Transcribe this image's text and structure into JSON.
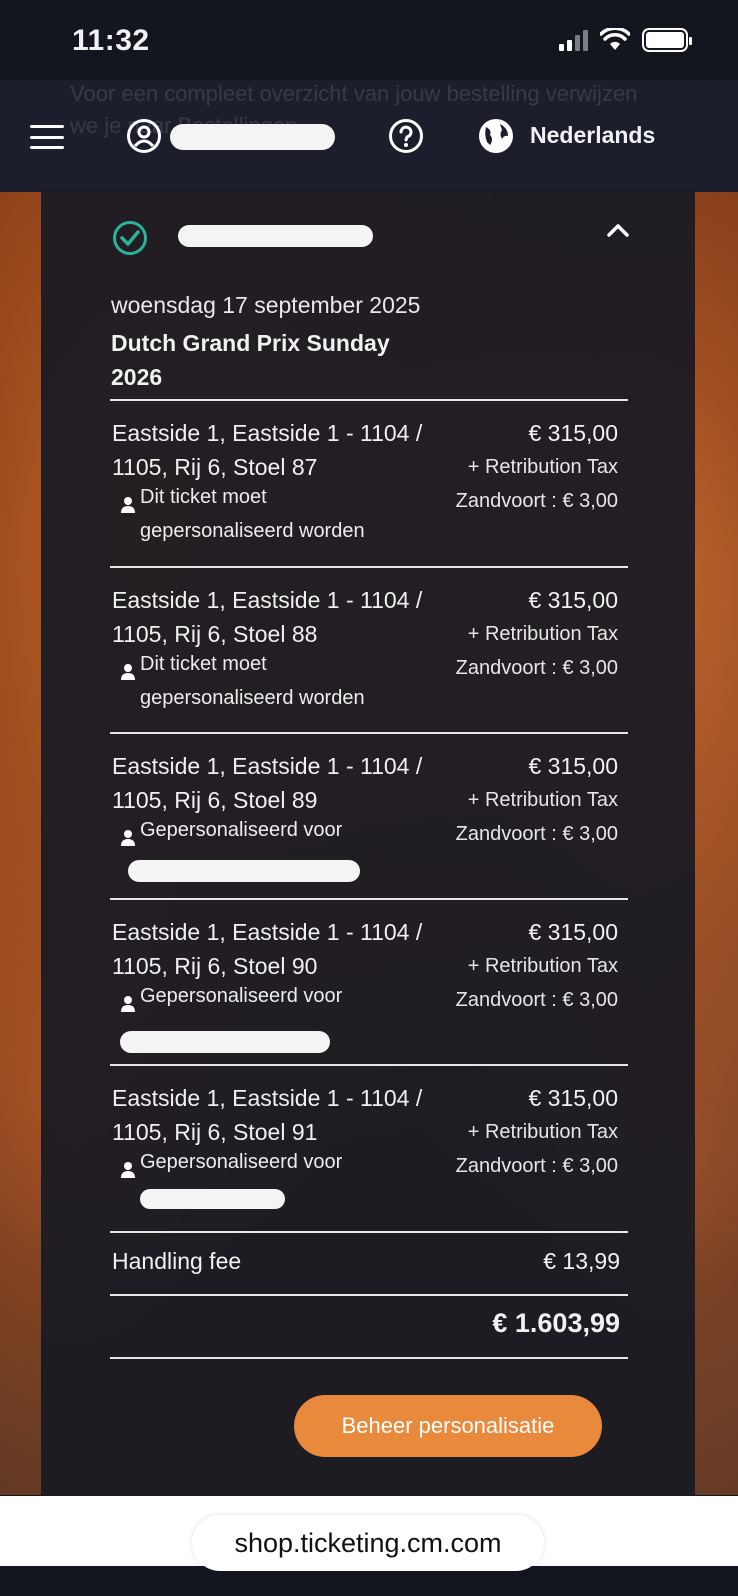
{
  "status_bar": {
    "time": "11:32"
  },
  "header": {
    "ghost_text": "Voor een compleet overzicht van jouw bestelling verwijzen we je naar Bestellingen",
    "language": "Nederlands"
  },
  "order": {
    "date": "woensdag 17 september 2025",
    "event": "Dutch Grand Prix Sunday 2026",
    "tickets": [
      {
        "name": "Eastside 1, Eastside 1 - 1104 / 1105, Rij 6, Stoel 87",
        "price": "€ 315,00",
        "tax_line1": "+ Retribution Tax",
        "tax_line2": "Zandvoort : € 3,00",
        "personalization": "Dit ticket moet gepersonaliseerd worden"
      },
      {
        "name": "Eastside 1, Eastside 1 - 1104 / 1105, Rij 6, Stoel 88",
        "price": "€ 315,00",
        "tax_line1": "+ Retribution Tax",
        "tax_line2": "Zandvoort : € 3,00",
        "personalization": "Dit ticket moet gepersonaliseerd worden"
      },
      {
        "name": "Eastside 1, Eastside 1 - 1104 / 1105, Rij 6, Stoel 89",
        "price": "€ 315,00",
        "tax_line1": "+ Retribution Tax",
        "tax_line2": "Zandvoort : € 3,00",
        "personalization": "Gepersonaliseerd voor"
      },
      {
        "name": "Eastside 1, Eastside 1 - 1104 / 1105, Rij 6, Stoel 90",
        "price": "€ 315,00",
        "tax_line1": "+ Retribution Tax",
        "tax_line2": "Zandvoort : € 3,00",
        "personalization": "Gepersonaliseerd voor"
      },
      {
        "name": "Eastside 1, Eastside 1 - 1104 / 1105, Rij 6, Stoel 91",
        "price": "€ 315,00",
        "tax_line1": "+ Retribution Tax",
        "tax_line2": "Zandvoort : € 3,00",
        "personalization": "Gepersonaliseerd voor"
      }
    ],
    "handling_fee_label": "Handling fee",
    "handling_fee_value": "€ 13,99",
    "total": "€ 1.603,99",
    "cta_label": "Beheer personalisatie"
  },
  "browser": {
    "url": "shop.ticketing.cm.com"
  },
  "colors": {
    "accent": "#e8893c",
    "check": "#2bb39a",
    "card": "#181a24"
  }
}
